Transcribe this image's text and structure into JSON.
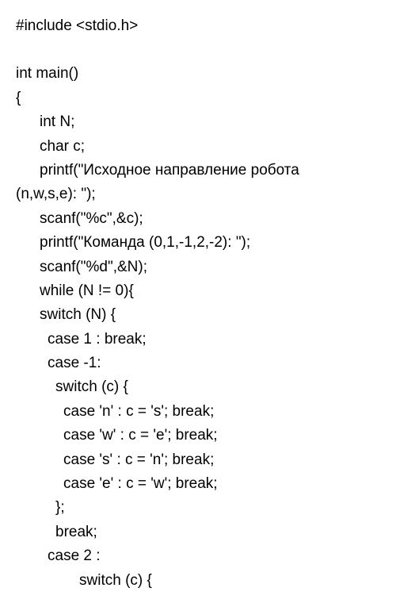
{
  "code": {
    "lines": [
      {
        "text": "#include <stdio.h>",
        "indent": 0
      },
      {
        "text": "",
        "indent": 0,
        "blank": true
      },
      {
        "text": "int main()",
        "indent": 0
      },
      {
        "text": "{",
        "indent": 0
      },
      {
        "text": "int N;",
        "indent": 1
      },
      {
        "text": "char c;",
        "indent": 1
      },
      {
        "text": "printf(\"Исходное направление робота",
        "indent": 1
      },
      {
        "text": "(n,w,s,e): \");",
        "indent": 0
      },
      {
        "text": "scanf(\"%c\",&c);",
        "indent": 1
      },
      {
        "text": "printf(\"Команда (0,1,-1,2,-2): \");",
        "indent": 1
      },
      {
        "text": "scanf(\"%d\",&N);",
        "indent": 1
      },
      {
        "text": "while (N != 0){",
        "indent": 1
      },
      {
        "text": "switch (N) {",
        "indent": 1
      },
      {
        "text": "case 1 : break;",
        "indent": 2
      },
      {
        "text": "case -1:",
        "indent": 2
      },
      {
        "text": "switch (c) {",
        "indent": 3
      },
      {
        "text": "case 'n' : c = 's'; break;",
        "indent": 4
      },
      {
        "text": "case 'w' : c = 'e'; break;",
        "indent": 4
      },
      {
        "text": "case 's' : c = 'n'; break;",
        "indent": 4
      },
      {
        "text": "case 'e' : c = 'w'; break;",
        "indent": 4
      },
      {
        "text": "};",
        "indent": 3
      },
      {
        "text": "break;",
        "indent": 3
      },
      {
        "text": "case 2 :",
        "indent": 2
      },
      {
        "text": "switch (c) {",
        "indent": 5
      }
    ]
  }
}
